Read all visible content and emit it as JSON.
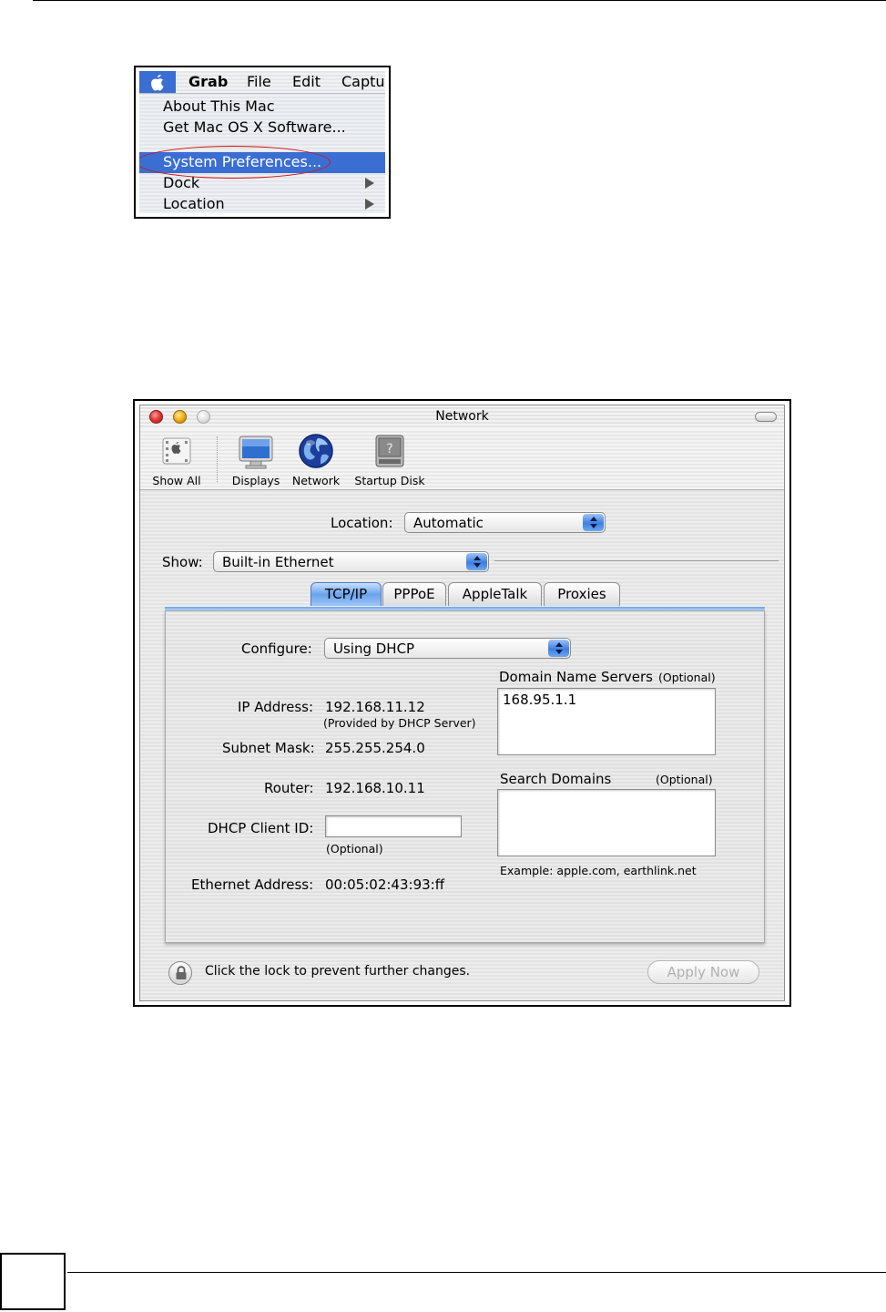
{
  "apple_menu": {
    "menubar": {
      "app": "Grab",
      "file": "File",
      "edit": "Edit",
      "capture": "Captu"
    },
    "items": [
      {
        "label": "About This Mac"
      },
      {
        "label": "Get Mac OS X Software..."
      },
      {
        "label": "System Preferences..."
      },
      {
        "label": "Dock"
      },
      {
        "label": "Location"
      }
    ],
    "selected_item": "System Preferences...",
    "highlight_color": "#3b6ed3",
    "annotation_color": "#d01010"
  },
  "network_window": {
    "title": "Network",
    "toolbar": {
      "show_all": "Show All",
      "displays": "Displays",
      "network": "Network",
      "startup_disk": "Startup Disk"
    },
    "location": {
      "label": "Location:",
      "value": "Automatic"
    },
    "show": {
      "label": "Show:",
      "value": "Built-in Ethernet"
    },
    "tabs": [
      {
        "label": "TCP/IP",
        "selected": true
      },
      {
        "label": "PPPoE",
        "selected": false
      },
      {
        "label": "AppleTalk",
        "selected": false
      },
      {
        "label": "Proxies",
        "selected": false
      }
    ],
    "tcpip": {
      "configure_label": "Configure:",
      "configure_value": "Using DHCP",
      "ip_label": "IP Address:",
      "ip_value": "192.168.11.12",
      "ip_note": "(Provided by DHCP Server)",
      "subnet_label": "Subnet Mask:",
      "subnet_value": "255.255.254.0",
      "router_label": "Router:",
      "router_value": "192.168.10.11",
      "dhcp_client_label": "DHCP Client ID:",
      "dhcp_client_value": "",
      "dhcp_client_note": "(Optional)",
      "ethernet_label": "Ethernet Address:",
      "ethernet_value": "00:05:02:43:93:ff",
      "dns_label": "Domain Name Servers",
      "dns_optional": "(Optional)",
      "dns_value": "168.95.1.1",
      "search_label": "Search Domains",
      "search_optional": "(Optional)",
      "search_value": "",
      "search_example": "Example: apple.com, earthlink.net"
    },
    "lock_text": "Click the lock to prevent further changes.",
    "apply_button": "Apply Now",
    "accent_color": "#3c7fe0"
  }
}
